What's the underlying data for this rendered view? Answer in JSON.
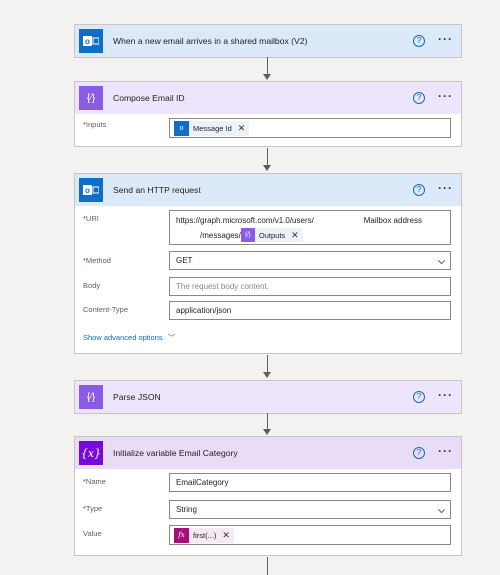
{
  "colors": {
    "background": "#f3f2f1",
    "outlook_blue": "#0f6fc6",
    "compose_purple": "#8a5ce6",
    "variable_purple": "#770bd6",
    "function_magenta": "#a3107a",
    "link_blue": "#0f6cbd",
    "required_red": "#a4262c"
  },
  "trigger": {
    "icon": "outlook-icon",
    "title": "When a new email arrives in a shared mailbox (V2)",
    "help": "?",
    "more": "···"
  },
  "compose": {
    "icon": "compose-icon",
    "icon_glyph": "{⁄}",
    "title": "Compose Email ID",
    "help": "?",
    "more": "···",
    "inputs_label": "Inputs",
    "inputs_token": "Message Id",
    "required_mark": "*"
  },
  "http": {
    "icon": "outlook-icon",
    "title": "Send an HTTP request",
    "help": "?",
    "more": "···",
    "required_mark": "*",
    "uri_label": "URI",
    "uri_line1": "https://graph.microsoft.com/v1.0/users/",
    "uri_note": "Mailbox address",
    "uri_line2": "/messages/",
    "uri_token": "Outputs",
    "method_label": "Method",
    "method_value": "GET",
    "body_label": "Body",
    "body_placeholder": "The request body content.",
    "content_type_label": "Content-Type",
    "content_type_value": "application/json",
    "advanced": "Show advanced options",
    "advanced_chevron": "﹀"
  },
  "parse": {
    "icon": "compose-icon",
    "icon_glyph": "{⁄}",
    "title": "Parse JSON",
    "help": "?",
    "more": "···"
  },
  "initvar": {
    "icon": "variable-icon",
    "icon_glyph": "{x}",
    "title": "Initialize variable Email Category",
    "help": "?",
    "more": "···",
    "required_mark": "*",
    "name_label": "Name",
    "name_value": "EmailCategory",
    "type_label": "Type",
    "type_value": "String",
    "value_label": "Value",
    "value_token": "first(...)",
    "fx_glyph": "fx"
  },
  "token_close": "✕"
}
